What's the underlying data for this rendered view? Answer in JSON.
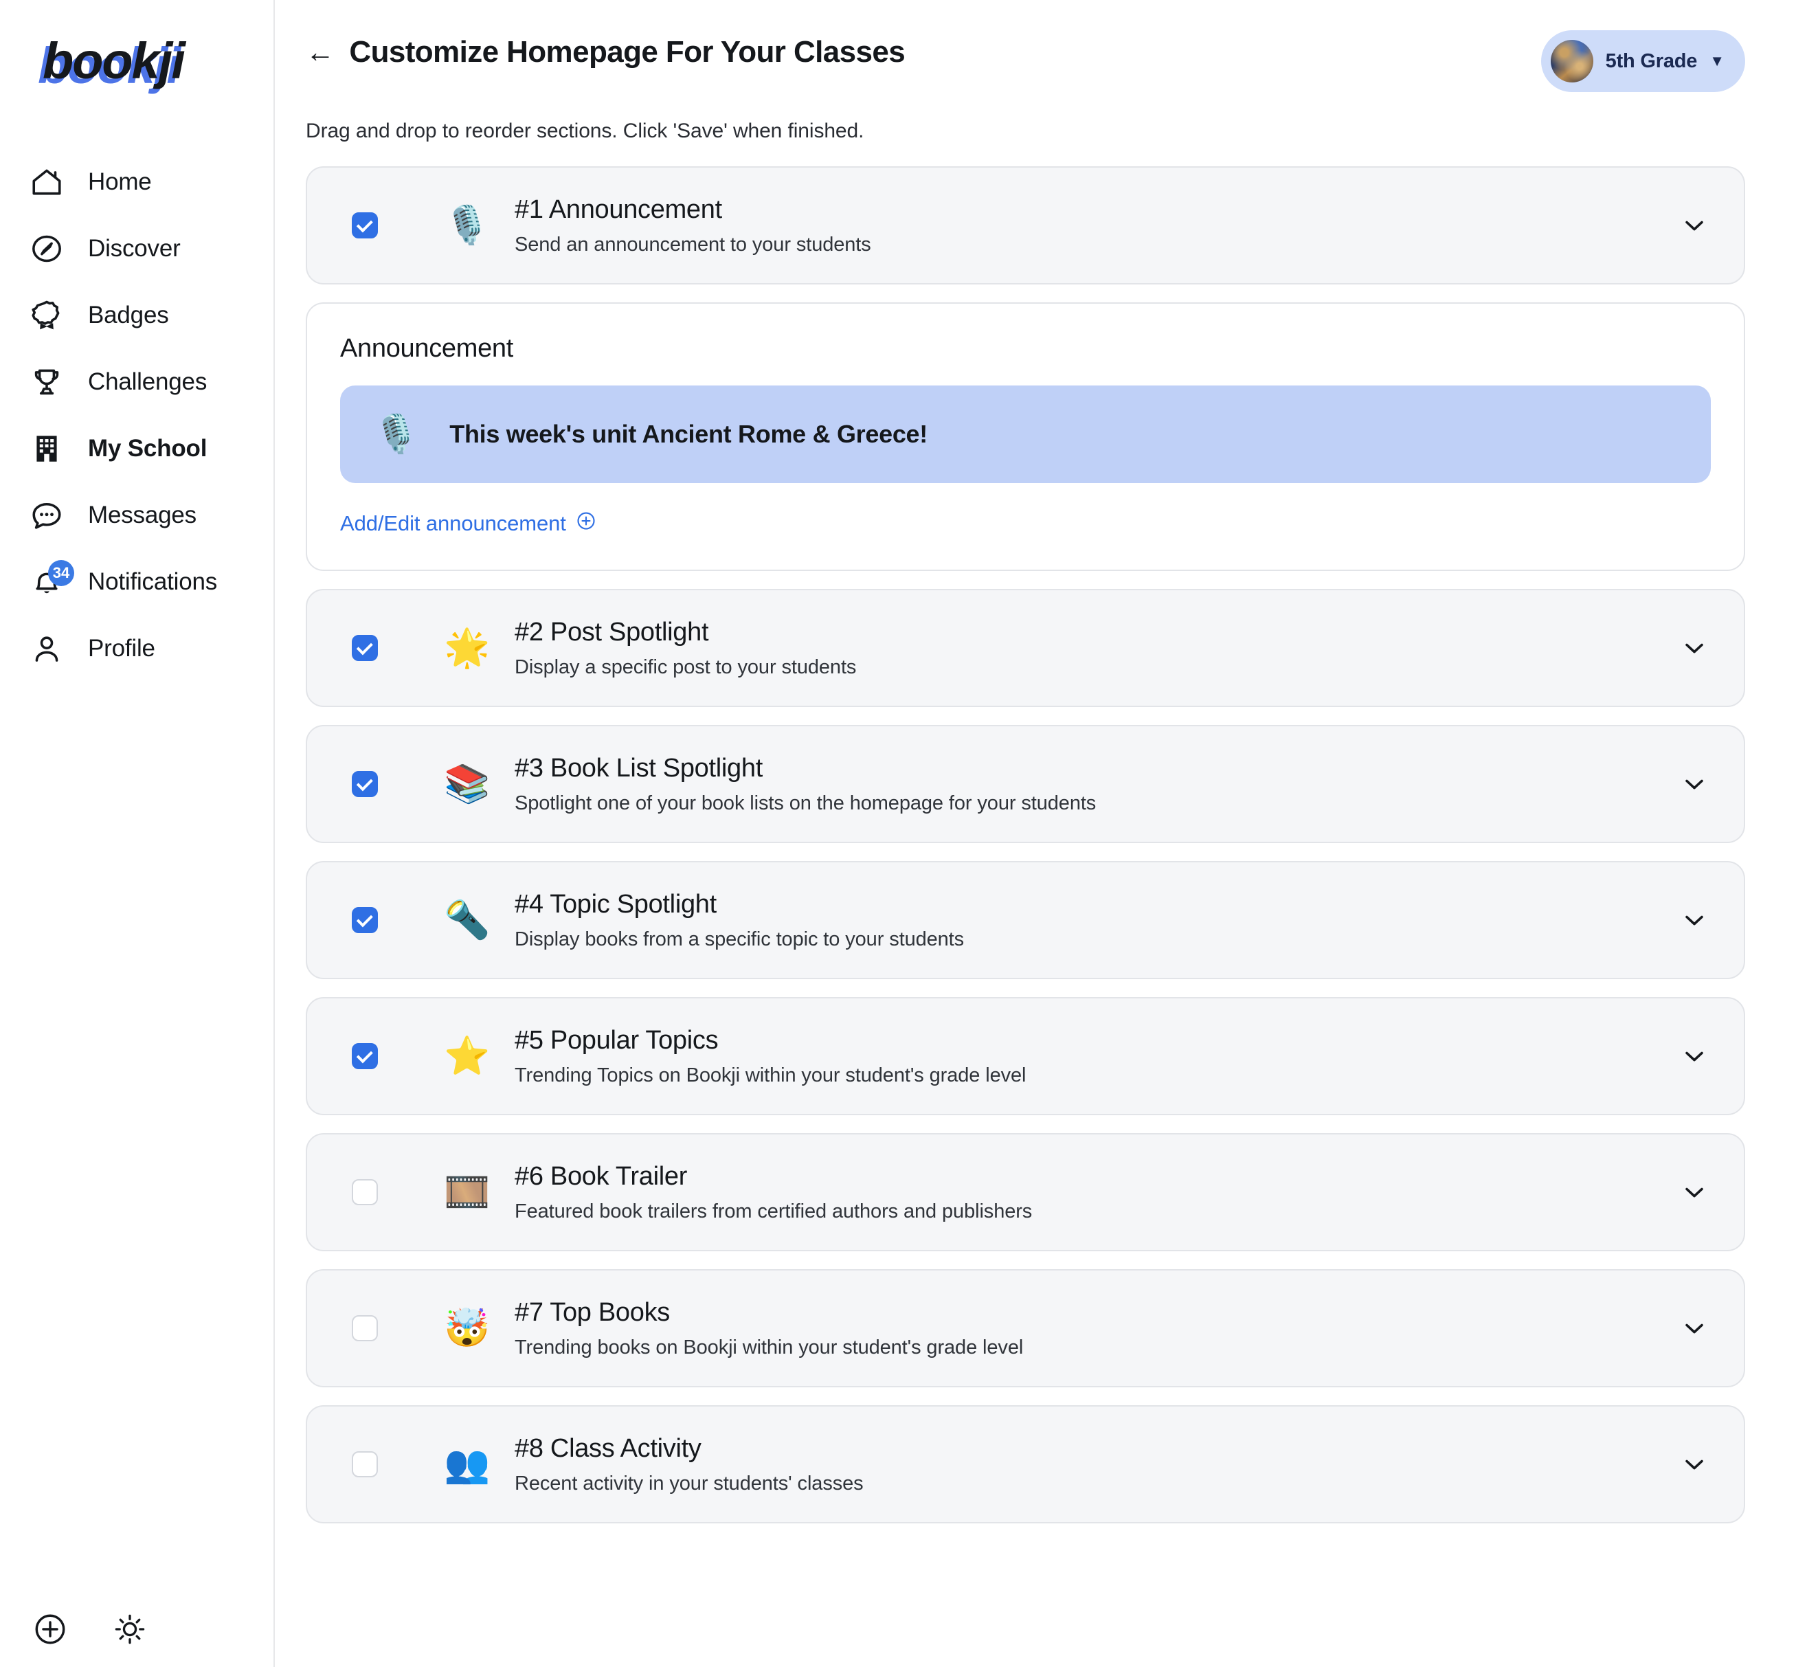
{
  "brand": {
    "name": "bookji"
  },
  "sidebar": {
    "items": [
      {
        "label": "Home",
        "icon": "home-icon",
        "active": false,
        "badge": ""
      },
      {
        "label": "Discover",
        "icon": "compass-icon",
        "active": false,
        "badge": ""
      },
      {
        "label": "Badges",
        "icon": "badge-ribbon-icon",
        "active": false,
        "badge": ""
      },
      {
        "label": "Challenges",
        "icon": "trophy-icon",
        "active": false,
        "badge": ""
      },
      {
        "label": "My School",
        "icon": "building-icon",
        "active": true,
        "badge": ""
      },
      {
        "label": "Messages",
        "icon": "chat-bubble-icon",
        "active": false,
        "badge": ""
      },
      {
        "label": "Notifications",
        "icon": "bell-icon",
        "active": false,
        "badge": "34"
      },
      {
        "label": "Profile",
        "icon": "user-icon",
        "active": false,
        "badge": ""
      }
    ],
    "bottom": [
      {
        "icon": "plus-circle-icon"
      },
      {
        "icon": "sun-icon"
      }
    ]
  },
  "header": {
    "back_label": "←",
    "title": "Customize Homepage For Your Classes",
    "grade_selector": {
      "label": "5th Grade",
      "caret": "▼",
      "avatar": "grade-avatar"
    }
  },
  "instructions": "Drag and drop to reorder sections. Click 'Save' when finished.",
  "announcement_panel": {
    "title": "Announcement",
    "banner_emoji": "🎙️",
    "banner_text": "This week's unit Ancient Rome & Greece!",
    "link_label": "Add/Edit announcement",
    "link_icon": "plus-circle-icon"
  },
  "sections": [
    {
      "title": "#1 Announcement",
      "desc": "Send an announcement to your students",
      "emoji": "🎙️",
      "emoji_name": "studio-microphone-emoji",
      "checked": true,
      "chevron": "chevron-down-icon"
    },
    {
      "title": "#2 Post Spotlight",
      "desc": "Display a specific post to your students",
      "emoji": "🌟",
      "emoji_name": "glowing-star-emoji",
      "checked": true,
      "chevron": "chevron-down-icon"
    },
    {
      "title": "#3 Book List Spotlight",
      "desc": "Spotlight one of your book lists on the homepage for your students",
      "emoji": "📚",
      "emoji_name": "books-emoji",
      "checked": true,
      "chevron": "chevron-down-icon"
    },
    {
      "title": "#4 Topic Spotlight",
      "desc": "Display books from a specific topic to your students",
      "emoji": "🔦",
      "emoji_name": "flashlight-emoji",
      "checked": true,
      "chevron": "chevron-down-icon"
    },
    {
      "title": "#5 Popular Topics",
      "desc": "Trending Topics on Bookji within your student's grade level",
      "emoji": "⭐",
      "emoji_name": "star-emoji",
      "checked": true,
      "chevron": "chevron-down-icon"
    },
    {
      "title": "#6 Book Trailer",
      "desc": "Featured book trailers from certified authors and publishers",
      "emoji": "🎞️",
      "emoji_name": "film-frames-emoji",
      "checked": false,
      "chevron": "chevron-down-icon"
    },
    {
      "title": "#7 Top Books",
      "desc": "Trending books on Bookji within your student's grade level",
      "emoji": "🤯",
      "emoji_name": "exploding-head-emoji",
      "checked": false,
      "chevron": "chevron-down-icon"
    },
    {
      "title": "#8 Class Activity",
      "desc": "Recent activity in your students' classes",
      "emoji": "👥",
      "emoji_name": "busts-in-silhouette-emoji",
      "checked": false,
      "chevron": "chevron-down-icon"
    }
  ],
  "colors": {
    "accent_blue": "#2f6fe4",
    "logo_shadow": "#4d74e8",
    "pill_bg": "#cedcf9",
    "pill_text": "#1b2a52",
    "banner_bg": "#bfd0f7",
    "card_bg": "#f5f6f8",
    "card_border": "#e2e4e8",
    "badge_bg": "#3b7ae4"
  }
}
